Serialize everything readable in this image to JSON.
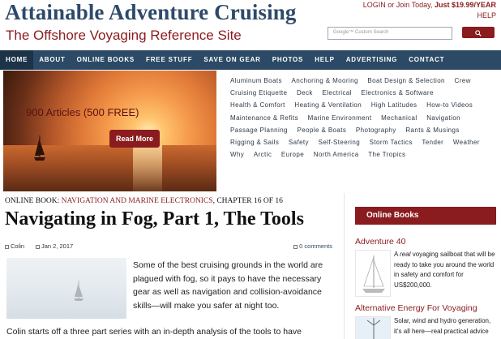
{
  "header": {
    "site_title": "Attainable Adventure Cruising",
    "tagline": "The Offshore Voyaging Reference Site",
    "login_text": "LOGIN or Join Today,",
    "price_text": "Just $19.99/YEAR",
    "help_text": "HELP",
    "search_placeholder": "Google™ Custom Search",
    "search_icon": "search-icon"
  },
  "nav": {
    "items": [
      "HOME",
      "ABOUT",
      "ONLINE BOOKS",
      "FREE STUFF",
      "SAVE ON GEAR",
      "PHOTOS",
      "HELP",
      "ADVERTISING",
      "CONTACT"
    ]
  },
  "hero": {
    "articles_text": "900 Articles (500 FREE)",
    "button_label": "Read More"
  },
  "categories": [
    "Aluminum Boats",
    "Anchoring & Mooring",
    "Boat Design & Selection",
    "Crew",
    "Cruising Etiquette",
    "Deck",
    "Electrical",
    "Electronics & Software",
    "Health & Comfort",
    "Heating & Ventilation",
    "High Latitudes",
    "How-to Videos",
    "Maintenance & Refits",
    "Marine Environment",
    "Mechanical",
    "Navigation",
    "Passage Planning",
    "People & Boats",
    "Photography",
    "Rants & Musings",
    "Rigging & Sails",
    "Safety",
    "Self-Steering",
    "Storm Tactics",
    "Tender",
    "Weather",
    "Why",
    "Arctic",
    "Europe",
    "North America",
    "The Tropics"
  ],
  "article": {
    "kicker_prefix": "ONLINE BOOK: ",
    "kicker_link": "NAVIGATION AND MARINE ELECTRONICS",
    "kicker_suffix": ", CHAPTER 16 OF 16",
    "title": "Navigating in Fog, Part 1, The Tools",
    "author": "Colin",
    "date": "Jan 2, 2017",
    "comments": "0 comments",
    "para1": "Some of the best cruising grounds in the world are plagued with fog, so it pays to have the necessary gear as well as navigation and collision-avoidance skills—will make you safer at night too.",
    "para2": "Colin starts off a three part series with an in-depth analysis of the tools to have"
  },
  "sidebar": {
    "heading": "Online Books",
    "items": [
      {
        "title": "Adventure 40",
        "desc_em": "real",
        "desc_before": "A ",
        "desc_after": " voyaging sailboat that will be ready to take you around the world in safety and comfort for US$200,000."
      },
      {
        "title": "Alternative Energy For Voyaging",
        "desc": "Solar, wind and hydro generation, it's all here—real practical advice"
      }
    ]
  }
}
